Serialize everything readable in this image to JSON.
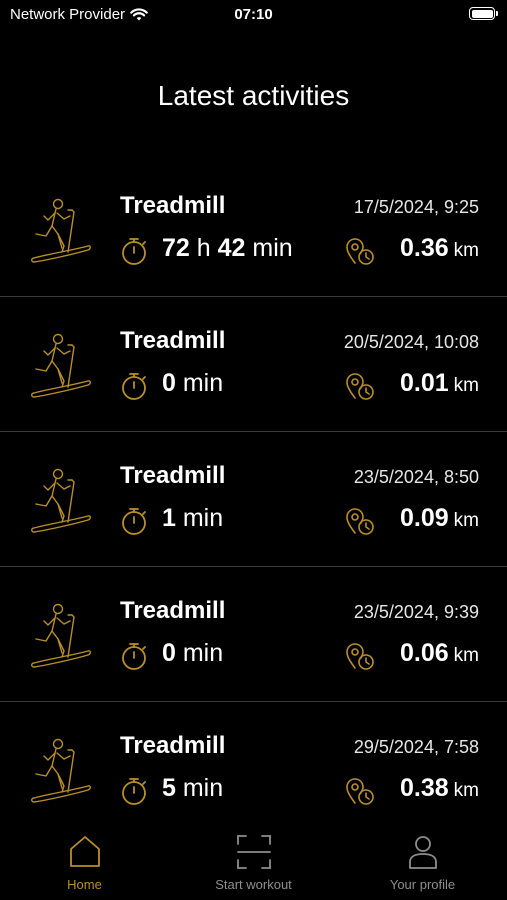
{
  "status_bar": {
    "carrier": "Network Provider",
    "time": "07:10"
  },
  "page": {
    "title": "Latest activities"
  },
  "activities": [
    {
      "name": "Treadmill",
      "date": "17/5/2024, 9:25",
      "duration": "72 h 42 min",
      "distance": "0.36",
      "unit": "km"
    },
    {
      "name": "Treadmill",
      "date": "20/5/2024, 10:08",
      "duration": "0 min",
      "distance": "0.01",
      "unit": "km"
    },
    {
      "name": "Treadmill",
      "date": "23/5/2024, 8:50",
      "duration": "1 min",
      "distance": "0.09",
      "unit": "km"
    },
    {
      "name": "Treadmill",
      "date": "23/5/2024, 9:39",
      "duration": "0 min",
      "distance": "0.06",
      "unit": "km"
    },
    {
      "name": "Treadmill",
      "date": "29/5/2024, 7:58",
      "duration": "5 min",
      "distance": "0.38",
      "unit": "km"
    }
  ],
  "tabs": [
    {
      "label": "Home",
      "icon": "home-icon",
      "active": true
    },
    {
      "label": "Start workout",
      "icon": "scan-icon",
      "active": false
    },
    {
      "label": "Your profile",
      "icon": "profile-icon",
      "active": false
    }
  ],
  "colors": {
    "accent": "#b98f2a",
    "background": "#000000",
    "divider": "#3a3a3a",
    "inactive_tab": "#8e8e8e"
  }
}
